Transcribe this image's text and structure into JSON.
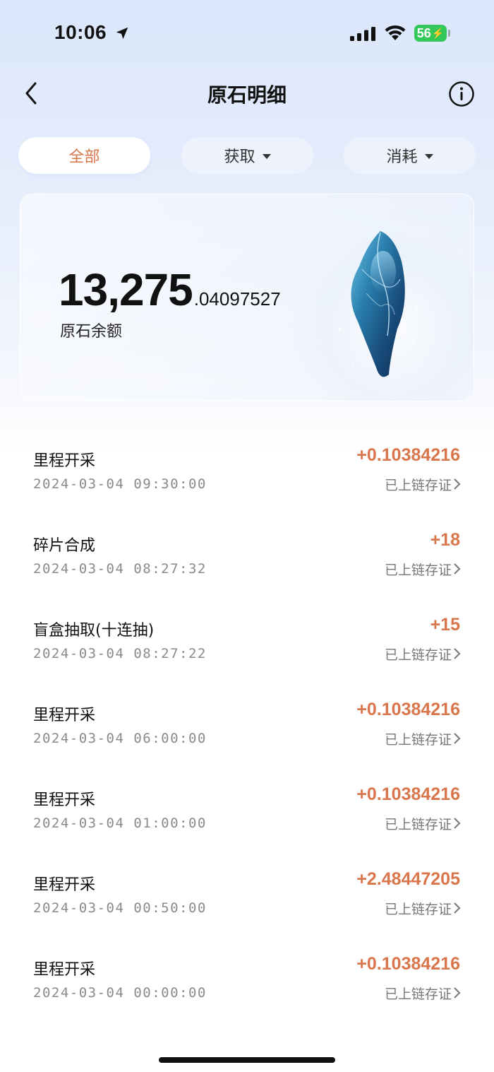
{
  "status_bar": {
    "time": "10:06",
    "battery": "56"
  },
  "header": {
    "title": "原石明细"
  },
  "tabs": [
    {
      "label": "全部",
      "active": true
    },
    {
      "label": "获取",
      "active": false
    },
    {
      "label": "消耗",
      "active": false
    }
  ],
  "balance": {
    "integer": "13,275",
    "decimal": ".04097527",
    "label": "原石余额"
  },
  "records": [
    {
      "title": "里程开采",
      "time": "2024-03-04 09:30:00",
      "amount": "+0.10384216",
      "status": "已上链存证"
    },
    {
      "title": "碎片合成",
      "time": "2024-03-04 08:27:32",
      "amount": "+18",
      "status": "已上链存证"
    },
    {
      "title": "盲盒抽取(十连抽)",
      "time": "2024-03-04 08:27:22",
      "amount": "+15",
      "status": "已上链存证"
    },
    {
      "title": "里程开采",
      "time": "2024-03-04 06:00:00",
      "amount": "+0.10384216",
      "status": "已上链存证"
    },
    {
      "title": "里程开采",
      "time": "2024-03-04 01:00:00",
      "amount": "+0.10384216",
      "status": "已上链存证"
    },
    {
      "title": "里程开采",
      "time": "2024-03-04 00:50:00",
      "amount": "+2.48447205",
      "status": "已上链存证"
    },
    {
      "title": "里程开采",
      "time": "2024-03-04 00:00:00",
      "amount": "+0.10384216",
      "status": "已上链存证"
    }
  ],
  "colors": {
    "accent": "#d9764b",
    "background_top": "#dbe6fb"
  },
  "icons": [
    "location-arrow-icon",
    "signal-icon",
    "wifi-icon",
    "back-chevron-icon",
    "info-icon",
    "chevron-right-icon",
    "gem-stone-icon"
  ]
}
